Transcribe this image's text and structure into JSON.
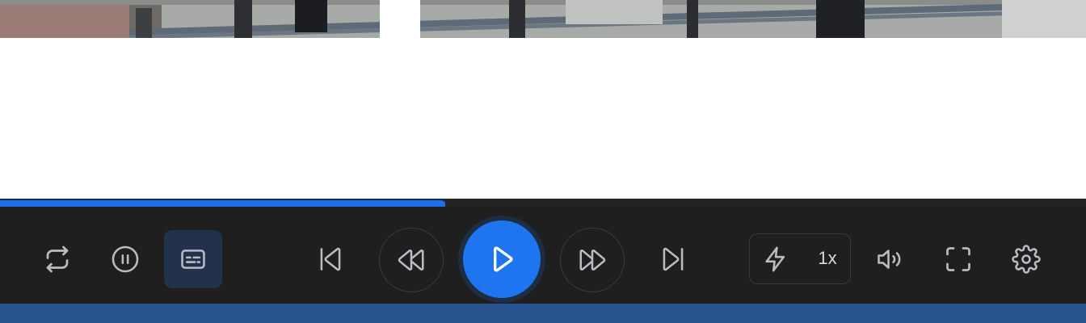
{
  "player": {
    "progress_fraction": 0.41,
    "colors": {
      "accent": "#1f74ef",
      "bar_background": "#1f1f1f",
      "bottom_band": "#2a5490",
      "icon": "#b9bcc3"
    },
    "controls_left": [
      {
        "icon": "repeat-icon"
      },
      {
        "icon": "pause-icon"
      },
      {
        "icon": "subtitles-icon",
        "active": true
      }
    ],
    "controls_center": [
      {
        "icon": "skip-previous-icon"
      },
      {
        "icon": "rewind-icon"
      },
      {
        "icon": "play-icon"
      },
      {
        "icon": "fast-forward-icon"
      },
      {
        "icon": "skip-next-icon"
      }
    ],
    "controls_right": [
      {
        "icon": "lightning-icon"
      },
      {
        "icon": "volume-icon"
      },
      {
        "icon": "fullscreen-icon"
      },
      {
        "icon": "settings-icon"
      }
    ],
    "speed_label": "1x"
  }
}
